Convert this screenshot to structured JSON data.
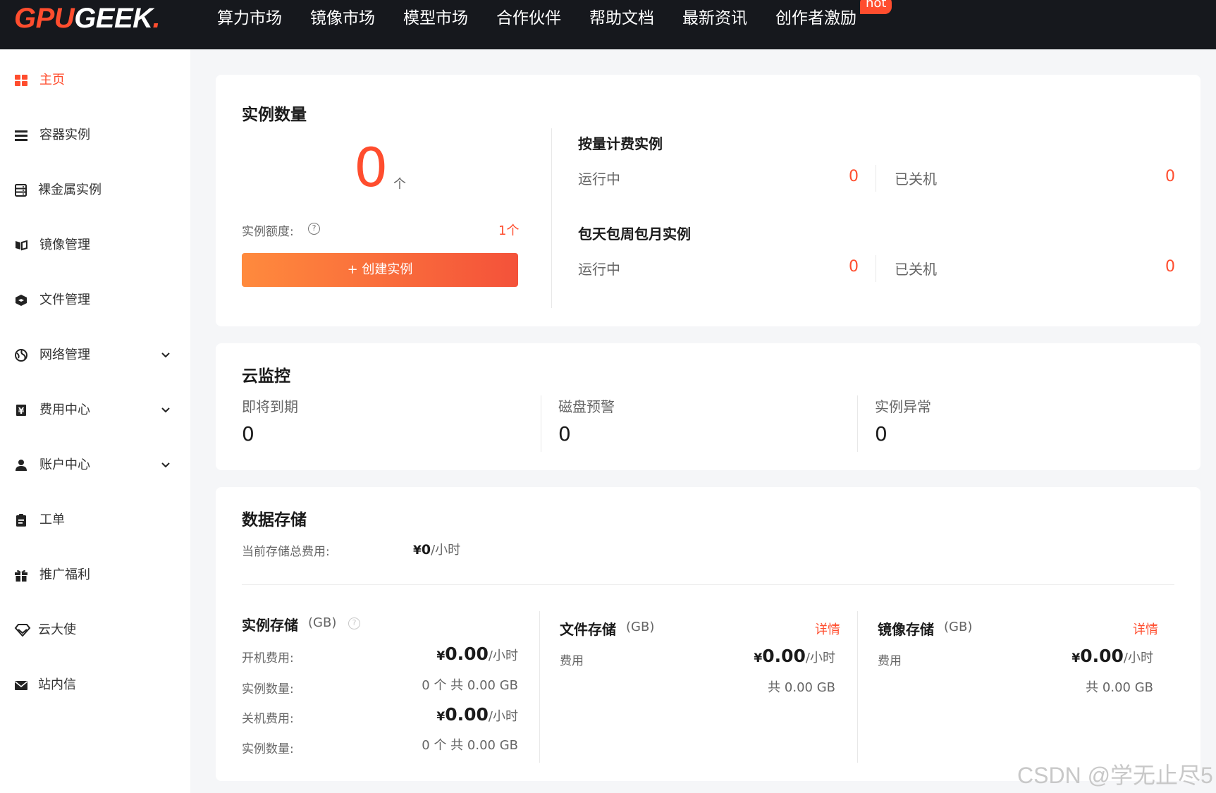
{
  "header": {
    "logo_gpu": "GPU",
    "logo_geek": "GEEK",
    "logo_dot": ".",
    "nav": [
      "算力市场",
      "镜像市场",
      "模型市场",
      "合作伙伴",
      "帮助文档",
      "最新资讯",
      "创作者激励"
    ],
    "hot_badge": "hot"
  },
  "sidebar": {
    "items": [
      {
        "label": "主页",
        "icon": "grid-icon",
        "active": true
      },
      {
        "label": "容器实例",
        "icon": "list-icon"
      },
      {
        "label": "裸金属实例",
        "icon": "server-icon"
      },
      {
        "label": "镜像管理",
        "icon": "image-icon"
      },
      {
        "label": "文件管理",
        "icon": "box-icon"
      },
      {
        "label": "网络管理",
        "icon": "globe-icon",
        "expandable": true
      },
      {
        "label": "费用中心",
        "icon": "yen-icon",
        "expandable": true
      },
      {
        "label": "账户中心",
        "icon": "user-icon",
        "expandable": true
      },
      {
        "label": "工单",
        "icon": "clipboard-icon"
      },
      {
        "label": "推广福利",
        "icon": "gift-icon"
      },
      {
        "label": "云大使",
        "icon": "diamond-icon"
      },
      {
        "label": "站内信",
        "icon": "mail-icon"
      }
    ]
  },
  "instances": {
    "title": "实例数量",
    "count": "0",
    "count_unit": "个",
    "quota_label": "实例额度:",
    "quota_value": "1个",
    "create_button": "+ 创建实例",
    "pay_as_you_go": {
      "title": "按量计费实例",
      "running_label": "运行中",
      "running_value": "0",
      "stopped_label": "已关机",
      "stopped_value": "0"
    },
    "subscription": {
      "title": "包天包周包月实例",
      "running_label": "运行中",
      "running_value": "0",
      "stopped_label": "已关机",
      "stopped_value": "0"
    }
  },
  "monitor": {
    "title": "云监控",
    "items": [
      {
        "label": "即将到期",
        "value": "0"
      },
      {
        "label": "磁盘预警",
        "value": "0"
      },
      {
        "label": "实例异常",
        "value": "0"
      }
    ]
  },
  "storage": {
    "title": "数据存储",
    "total_label": "当前存储总费用:",
    "total_currency": "¥",
    "total_value": "0",
    "total_unit": "/小时",
    "instance": {
      "title": "实例存储",
      "unit": "(GB)",
      "on_fee_label": "开机费用:",
      "on_fee_currency": "¥",
      "on_fee_value": "0.00",
      "on_fee_unit": "/小时",
      "on_count_label": "实例数量:",
      "on_count_value": "0 个 共 0.00 GB",
      "off_fee_label": "关机费用:",
      "off_fee_currency": "¥",
      "off_fee_value": "0.00",
      "off_fee_unit": "/小时",
      "off_count_label": "实例数量:",
      "off_count_value": "0 个 共 0.00 GB"
    },
    "file": {
      "title": "文件存储",
      "unit": "(GB)",
      "detail": "详情",
      "fee_label": "费用",
      "fee_currency": "¥",
      "fee_value": "0.00",
      "fee_unit": "/小时",
      "total": "共 0.00 GB"
    },
    "image": {
      "title": "镜像存储",
      "unit": "(GB)",
      "detail": "详情",
      "fee_label": "费用",
      "fee_currency": "¥",
      "fee_value": "0.00",
      "fee_unit": "/小时",
      "total": "共 0.00 GB"
    }
  },
  "watermark": "CSDN @学无止尽5",
  "colors": {
    "accent": "#ff4d2e",
    "topbar": "#16181d",
    "button_gradient_start": "#ff8a3d",
    "button_gradient_end": "#f4523a"
  }
}
